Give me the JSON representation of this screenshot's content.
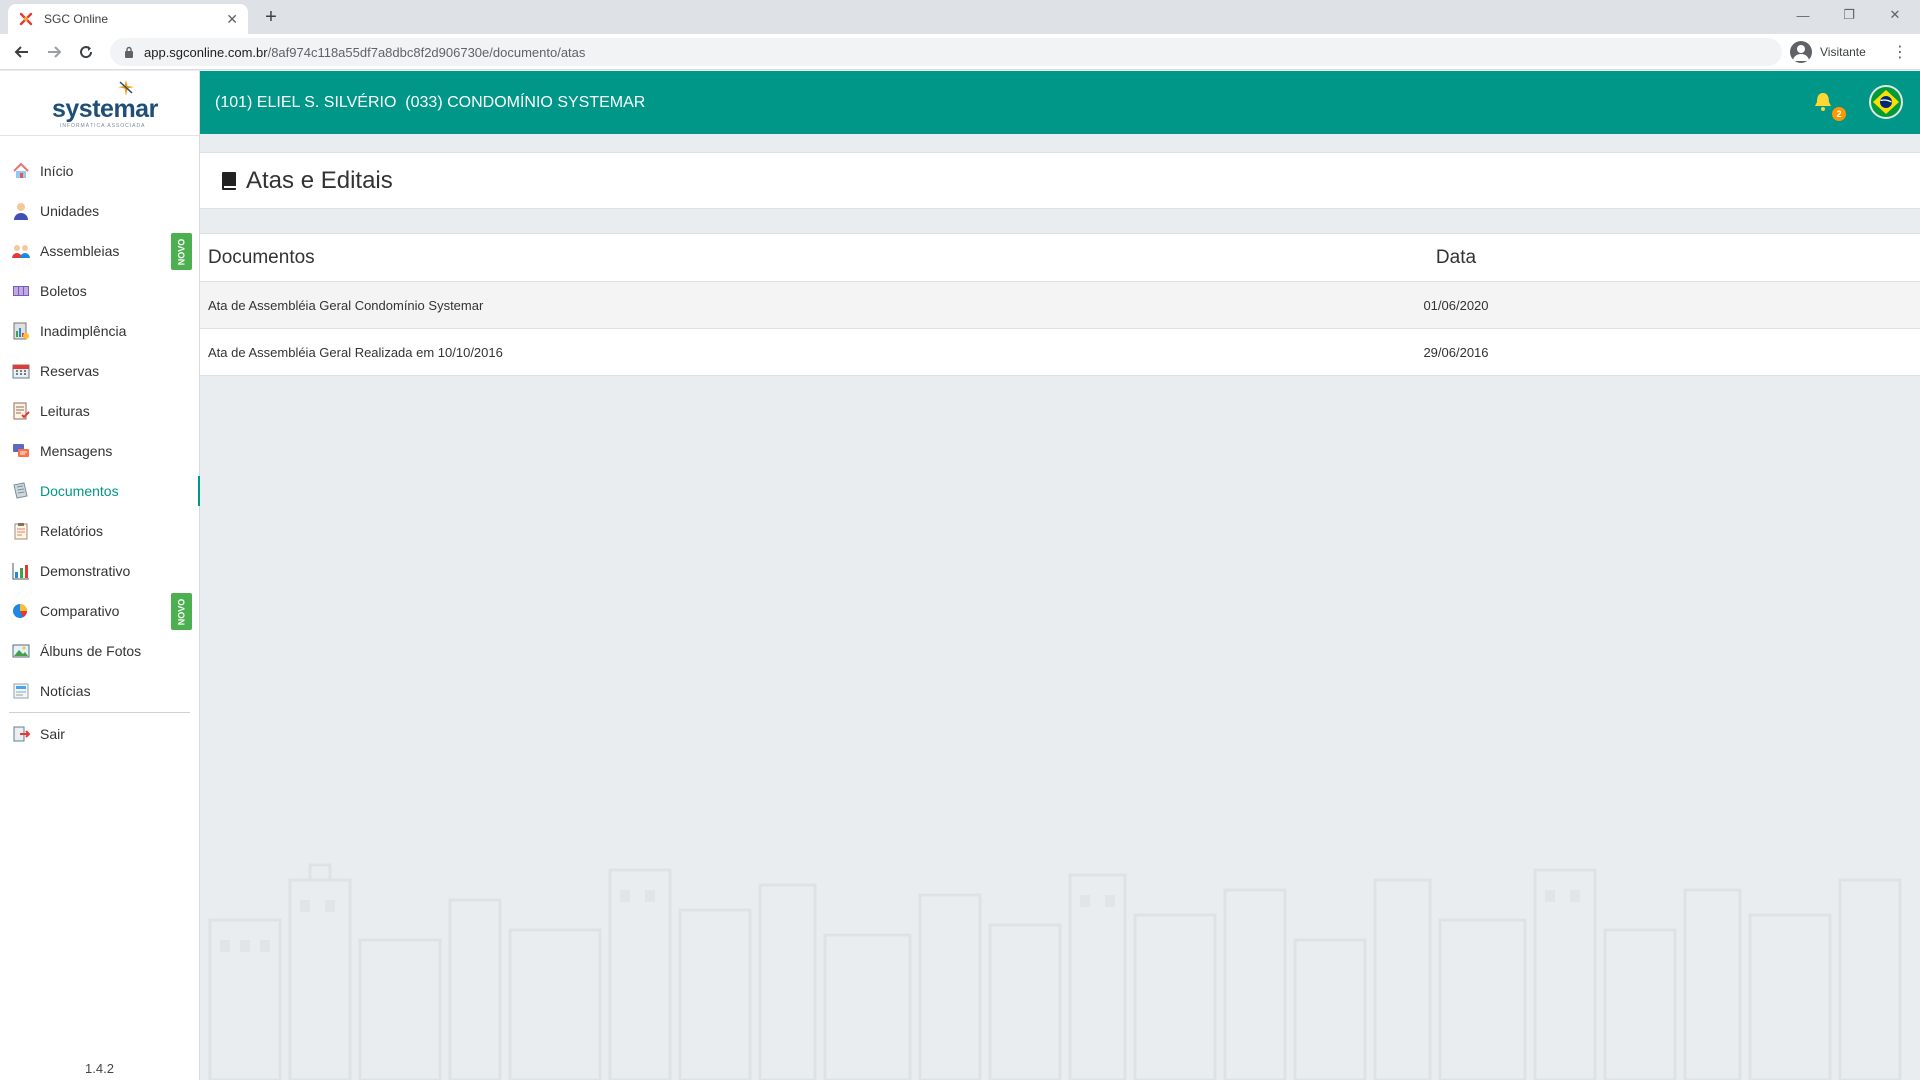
{
  "browser": {
    "tab_title": "SGC Online",
    "url_host": "app.sgconline.com.br",
    "url_path": "/8af974c118a55df7a8dbc8f2d906730e/documento/atas",
    "profile_label": "Visitante"
  },
  "sidebar": {
    "logo_text": "systemar",
    "logo_subtitle": "INFORMÁTICA ASSOCIADA",
    "items": [
      {
        "label": "Início",
        "icon": "home-icon"
      },
      {
        "label": "Unidades",
        "icon": "person-icon"
      },
      {
        "label": "Assembleias",
        "icon": "people-icon",
        "badge": "NOVO"
      },
      {
        "label": "Boletos",
        "icon": "barcode-icon"
      },
      {
        "label": "Inadimplência",
        "icon": "report-icon"
      },
      {
        "label": "Reservas",
        "icon": "calendar-icon"
      },
      {
        "label": "Leituras",
        "icon": "checklist-icon"
      },
      {
        "label": "Mensagens",
        "icon": "messages-icon"
      },
      {
        "label": "Documentos",
        "icon": "documents-icon",
        "active": true
      },
      {
        "label": "Relatórios",
        "icon": "clipboard-icon"
      },
      {
        "label": "Demonstrativo",
        "icon": "chart-icon"
      },
      {
        "label": "Comparativo",
        "icon": "pie-chart-icon",
        "badge": "NOVO"
      },
      {
        "label": "Álbuns de Fotos",
        "icon": "photo-icon"
      },
      {
        "label": "Notícias",
        "icon": "news-icon"
      }
    ],
    "logout_label": "Sair",
    "version": "1.4.2"
  },
  "header": {
    "title": "(101) ELIEL S. SILVÉRIO  (033) CONDOMÍNIO SYSTEMAR",
    "notification_count": "2",
    "accent_color": "#009688"
  },
  "main": {
    "page_title": "Atas e Editais",
    "table": {
      "columns": [
        "Documentos",
        "Data"
      ],
      "rows": [
        {
          "document": "Ata de Assembléia Geral Condomínio Systemar",
          "date": "01/06/2020"
        },
        {
          "document": "Ata de Assembléia Geral Realizada em 10/10/2016",
          "date": "29/06/2016"
        }
      ]
    }
  }
}
